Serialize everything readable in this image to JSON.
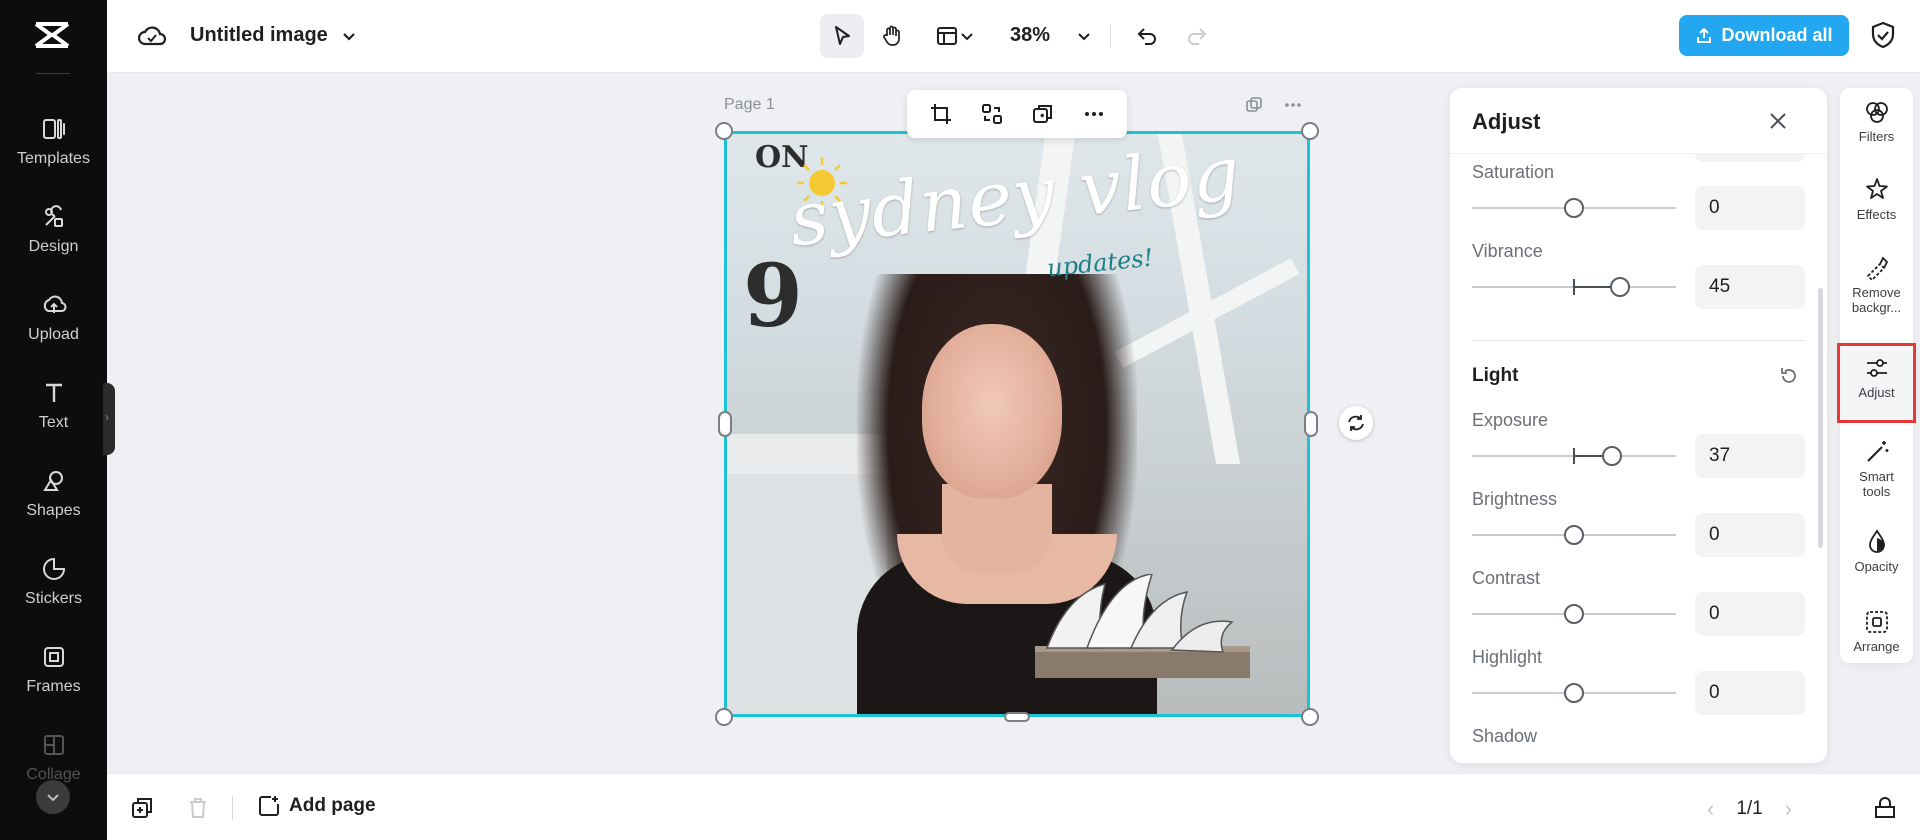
{
  "colors": {
    "sidebar_bg": "#0d0d0d",
    "accent": "#22a7f0",
    "selection": "#1dc2d4",
    "highlight": "#e53935"
  },
  "sidebar": {
    "items": [
      {
        "label": "Templates",
        "icon": "templates-icon"
      },
      {
        "label": "Design",
        "icon": "design-icon"
      },
      {
        "label": "Upload",
        "icon": "upload-icon"
      },
      {
        "label": "Text",
        "icon": "text-icon"
      },
      {
        "label": "Shapes",
        "icon": "shapes-icon"
      },
      {
        "label": "Stickers",
        "icon": "stickers-icon"
      },
      {
        "label": "Frames",
        "icon": "frames-icon"
      },
      {
        "label": "Collage",
        "icon": "collage-icon"
      }
    ]
  },
  "header": {
    "title": "Untitled image",
    "zoom": "38%",
    "download_label": "Download all"
  },
  "canvas": {
    "page_label": "Page 1",
    "artwork_title": "sydney vlog",
    "artwork_subtitle": "updates!"
  },
  "adjust": {
    "title": "Adjust",
    "color_sliders": [
      {
        "label": "Saturation",
        "value": "0",
        "fraction": 0.5,
        "offset": 0
      },
      {
        "label": "Vibrance",
        "value": "45",
        "fraction": 0.725,
        "offset": 45
      }
    ],
    "light_section": "Light",
    "light_sliders": [
      {
        "label": "Exposure",
        "value": "37",
        "fraction": 0.685,
        "offset": 37
      },
      {
        "label": "Brightness",
        "value": "0",
        "fraction": 0.5,
        "offset": 0
      },
      {
        "label": "Contrast",
        "value": "0",
        "fraction": 0.5,
        "offset": 0
      },
      {
        "label": "Highlight",
        "value": "0",
        "fraction": 0.5,
        "offset": 0
      }
    ],
    "cut_label": "Shadow"
  },
  "rail": {
    "items": [
      {
        "label": "Filters",
        "icon": "filters-icon"
      },
      {
        "label": "Effects",
        "icon": "effects-icon"
      },
      {
        "label": "Remove backgr...",
        "icon": "remove-background-icon"
      },
      {
        "label": "Adjust",
        "icon": "adjust-icon",
        "selected": true
      },
      {
        "label": "Smart tools",
        "icon": "smart-tools-icon"
      },
      {
        "label": "Opacity",
        "icon": "opacity-icon"
      },
      {
        "label": "Arrange",
        "icon": "arrange-icon"
      }
    ]
  },
  "footer": {
    "add_page_label": "Add page",
    "page_indicator": "1/1"
  }
}
